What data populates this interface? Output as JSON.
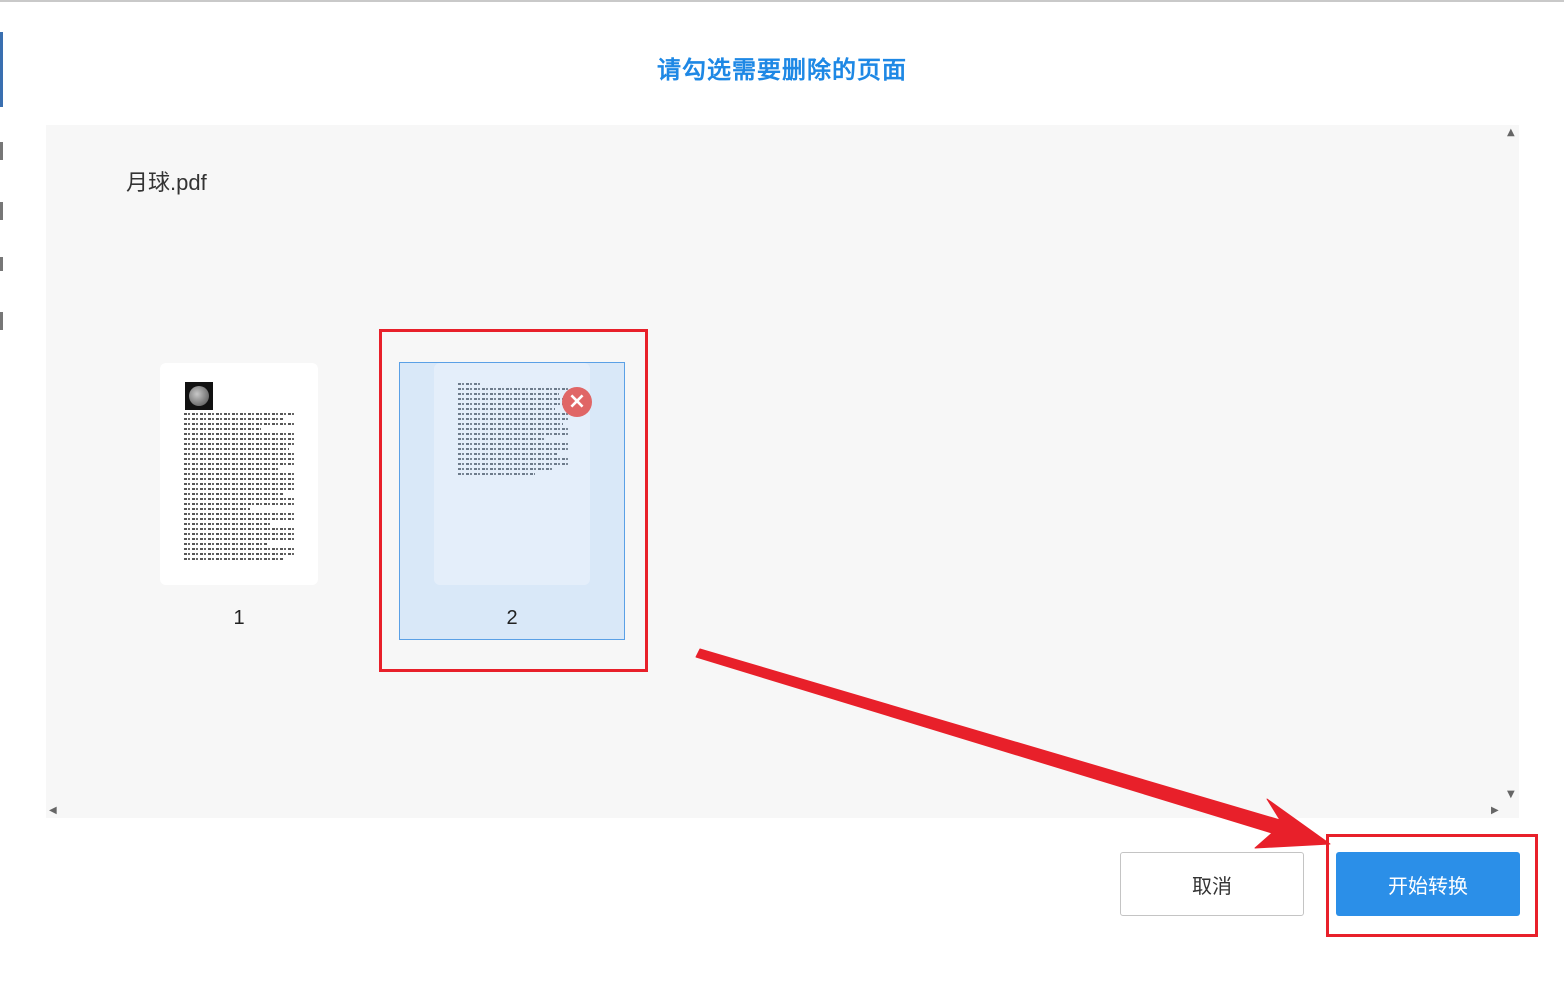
{
  "dialog": {
    "title": "请勾选需要删除的页面"
  },
  "file": {
    "name": "月球.pdf",
    "pages": [
      {
        "number": "1",
        "selected": false
      },
      {
        "number": "2",
        "selected": true
      }
    ]
  },
  "buttons": {
    "cancel_label": "取消",
    "start_label": "开始转换"
  },
  "icons": {
    "remove": "close-circle-icon",
    "scroll_up": "triangle-up-icon",
    "scroll_down": "triangle-down-icon",
    "scroll_left": "triangle-left-icon",
    "scroll_right": "triangle-right-icon"
  },
  "colors": {
    "title": "#1e88e5",
    "primary_button": "#2b8fe8",
    "selection_fill": "#d9e8f8",
    "selection_border": "#5aa0e6",
    "annotation_red": "#e8202a",
    "remove_icon": "#e06666",
    "panel_background": "#f7f7f7"
  }
}
